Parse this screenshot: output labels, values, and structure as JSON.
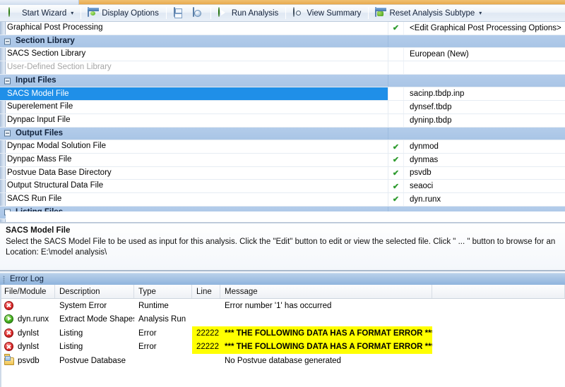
{
  "toolbar": {
    "items": [
      {
        "label": "Start Wizard",
        "icon": "green-ball-icon",
        "caret": "▾"
      },
      {
        "label": "Display Options",
        "icon": "display-options-icon",
        "caret": ""
      },
      {
        "label": "Run Analysis",
        "icon": "run-icon",
        "caret": ""
      },
      {
        "label": "View Summary",
        "icon": "gear-icon",
        "caret": ""
      },
      {
        "label": "Reset Analysis Subtype",
        "icon": "reset-icon",
        "caret": "▾"
      }
    ],
    "save_tooltip": "Save",
    "save_as_tooltip": "Save As"
  },
  "grid": {
    "rows": [
      {
        "type": "item",
        "name": "Graphical Post Processing",
        "check": "✔",
        "value": "<Edit Graphical Post Processing Options>",
        "selected": false,
        "disabled": false
      },
      {
        "type": "group",
        "name": "Section Library",
        "check": "",
        "value": "",
        "selected": false,
        "disabled": false
      },
      {
        "type": "item",
        "name": "SACS Section Library",
        "check": "",
        "value": "European (New)",
        "selected": false,
        "disabled": false
      },
      {
        "type": "item",
        "name": "User-Defined Section Library",
        "check": "",
        "value": "",
        "selected": false,
        "disabled": true
      },
      {
        "type": "group",
        "name": "Input Files",
        "check": "",
        "value": "",
        "selected": false,
        "disabled": false
      },
      {
        "type": "item",
        "name": "SACS Model File",
        "check": "",
        "value": "sacinp.tbdp.inp",
        "selected": true,
        "disabled": false
      },
      {
        "type": "item",
        "name": "Superelement File",
        "check": "",
        "value": "dynsef.tbdp",
        "selected": false,
        "disabled": false
      },
      {
        "type": "item",
        "name": "Dynpac Input File",
        "check": "",
        "value": "dyninp.tbdp",
        "selected": false,
        "disabled": false
      },
      {
        "type": "group",
        "name": "Output Files",
        "check": "",
        "value": "",
        "selected": false,
        "disabled": false
      },
      {
        "type": "item",
        "name": "Dynpac Modal Solution File",
        "check": "✔",
        "value": "dynmod",
        "selected": false,
        "disabled": false
      },
      {
        "type": "item",
        "name": "Dynpac Mass File",
        "check": "✔",
        "value": "dynmas",
        "selected": false,
        "disabled": false
      },
      {
        "type": "item",
        "name": "Postvue Data Base Directory",
        "check": "✔",
        "value": "psvdb",
        "selected": false,
        "disabled": false
      },
      {
        "type": "item",
        "name": "Output Structural Data File",
        "check": "✔",
        "value": "seaoci",
        "selected": false,
        "disabled": false
      },
      {
        "type": "item",
        "name": "SACS Run File",
        "check": "✔",
        "value": "dyn.runx",
        "selected": false,
        "disabled": false
      },
      {
        "type": "group",
        "name": "Listing Files",
        "check": "",
        "value": "",
        "selected": false,
        "disabled": false
      }
    ]
  },
  "description": {
    "title": "SACS Model File",
    "line1": "Select the SACS Model File to be used as input for this analysis.  Click the \"Edit\" button to edit or view the selected file. Click \" ... \" button to browse for an",
    "line2": "Location: E:\\model analysis\\"
  },
  "error_log": {
    "title": "Error Log",
    "columns": [
      "File/Module",
      "Description",
      "Type",
      "Line",
      "Message",
      ""
    ],
    "rows": [
      {
        "icon": "error-icon",
        "file": "",
        "desc": "System Error",
        "type": "Runtime",
        "line": "",
        "msg": "Error number '1' has occurred",
        "highlight": false
      },
      {
        "icon": "run-icon",
        "file": "dyn.runx",
        "desc": "Extract Mode Shapes",
        "type": "Analysis Run",
        "line": "",
        "msg": "",
        "highlight": false
      },
      {
        "icon": "error-icon",
        "file": "dynlst",
        "desc": "Listing",
        "type": "Error",
        "line": "22222",
        "msg": "*** THE FOLLOWING DATA HAS A FORMAT ERROR ***",
        "highlight": true
      },
      {
        "icon": "error-icon",
        "file": "dynlst",
        "desc": "Listing",
        "type": "Error",
        "line": "22222",
        "msg": "*** THE FOLLOWING DATA HAS A FORMAT ERROR ***",
        "highlight": true
      },
      {
        "icon": "folder-icon",
        "file": "psvdb",
        "desc": "Postvue Database",
        "type": "",
        "line": "",
        "msg": "No Postvue database generated",
        "highlight": false
      }
    ]
  },
  "colors": {
    "selection": "#1f8fe8",
    "group_header": "#adc8e7",
    "highlight": "#ffff00",
    "check_green": "#2e9b2e",
    "error_red": "#e03030"
  }
}
